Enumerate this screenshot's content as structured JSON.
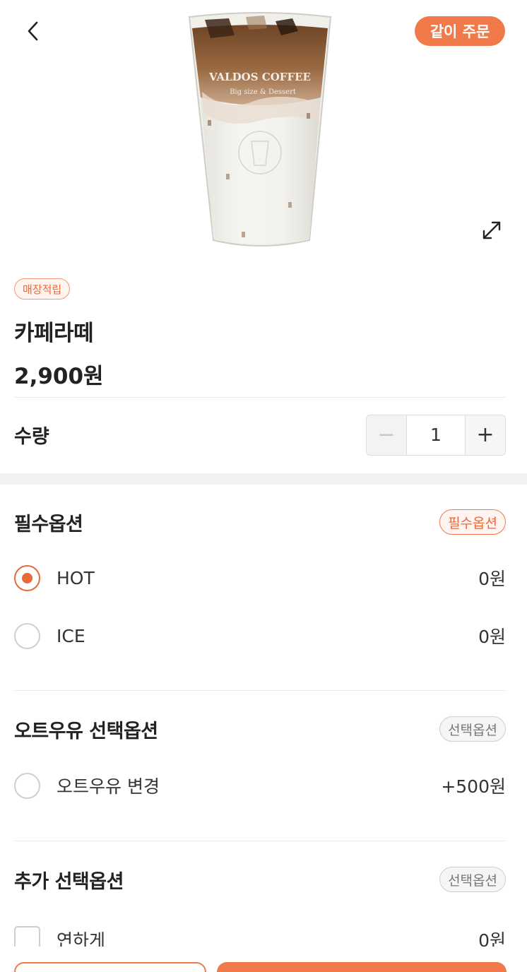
{
  "header": {
    "back_icon": "chevron-left-icon",
    "together_order_label": "같이 주문",
    "expand_icon": "expand-arrows-icon"
  },
  "image": {
    "cup_text_line1": "VALDOS COFFEE",
    "cup_text_line2": "Big size & Dessert"
  },
  "product": {
    "badge": "매장적립",
    "name": "카페라떼",
    "price": "2,900원"
  },
  "quantity": {
    "label": "수량",
    "value": "1",
    "minus": "−",
    "plus": "+"
  },
  "required_section": {
    "title": "필수옵션",
    "tag": "필수옵션",
    "options": [
      {
        "label": "HOT",
        "price": "0원",
        "selected": true
      },
      {
        "label": "ICE",
        "price": "0원",
        "selected": false
      }
    ]
  },
  "oat_section": {
    "title": "오트우유 선택옵션",
    "tag": "선택옵션",
    "options": [
      {
        "label": "오트우유 변경",
        "price": "+500원",
        "selected": false
      }
    ]
  },
  "extra_section": {
    "title": "추가 선택옵션",
    "tag": "선택옵션",
    "options": [
      {
        "label": "연하게",
        "price": "0원",
        "checked": false
      }
    ]
  },
  "colors": {
    "accent": "#f07a4a",
    "accent_text": "#e8683a"
  }
}
